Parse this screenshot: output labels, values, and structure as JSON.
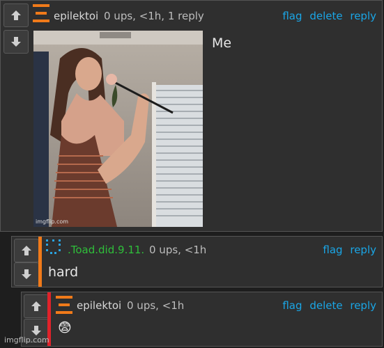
{
  "comments": [
    {
      "username": "epilektoi",
      "meta": "0 ups, <1h, 1 reply",
      "actions": {
        "flag": "flag",
        "delete": "delete",
        "reply": "reply"
      },
      "text": "Me",
      "image_watermark": "imgflip.com"
    },
    {
      "username": ".Toad.did.9.11.",
      "meta": "0 ups, <1h",
      "actions": {
        "flag": "flag",
        "reply": "reply"
      },
      "text": "hard"
    },
    {
      "username": "epilektoi",
      "meta": "0 ups, <1h",
      "actions": {
        "flag": "flag",
        "delete": "delete",
        "reply": "reply"
      },
      "text": "😨"
    }
  ],
  "footer_watermark": "imgflip.com",
  "colors": {
    "background": "#1e1e1e",
    "panel": "#2f2f2f",
    "link": "#1aa6e6",
    "orange_accent": "#f07a1a",
    "red_accent": "#e0222a",
    "green_username": "#2fbf3a",
    "blue_avatar": "#2aa3e0"
  },
  "icons": [
    "upvote-arrow-icon",
    "downvote-arrow-icon",
    "avatar-icon"
  ]
}
